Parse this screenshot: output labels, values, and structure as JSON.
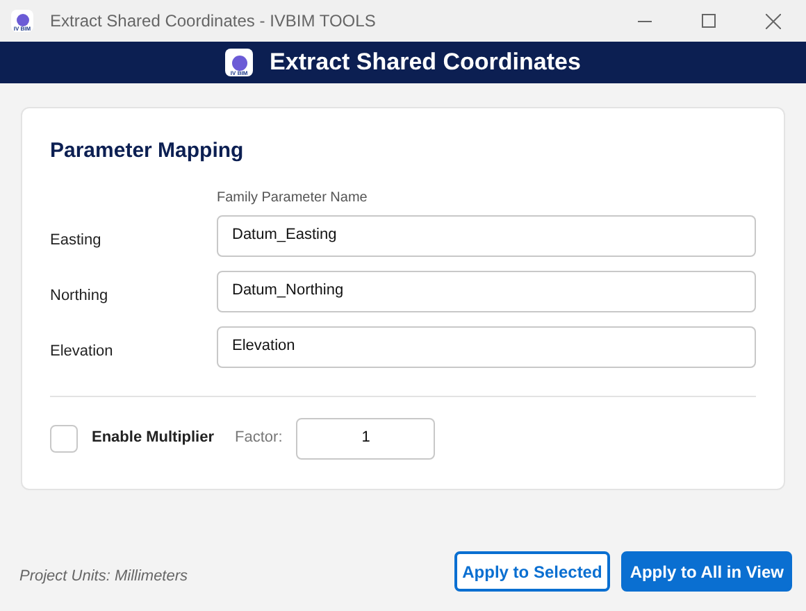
{
  "window": {
    "title": "Extract Shared Coordinates - IVBIM TOOLS",
    "logo": "IV BIM"
  },
  "header": {
    "title": "Extract Shared Coordinates",
    "logo": "IV BIM"
  },
  "card": {
    "title": "Parameter Mapping",
    "column_heading": "Family Parameter Name",
    "rows": [
      {
        "label": "Easting",
        "value": "Datum_Easting"
      },
      {
        "label": "Northing",
        "value": "Datum_Northing"
      },
      {
        "label": "Elevation",
        "value": "Elevation"
      }
    ],
    "multiplier": {
      "label": "Enable Multiplier",
      "checked": false,
      "factor_label": "Factor:",
      "factor": "1"
    }
  },
  "footer": {
    "units": "Project Units: Millimeters",
    "buttons": [
      {
        "label": "Apply to Selected",
        "kind": "outline"
      },
      {
        "label": "Apply to All in View",
        "kind": "primary"
      }
    ]
  }
}
